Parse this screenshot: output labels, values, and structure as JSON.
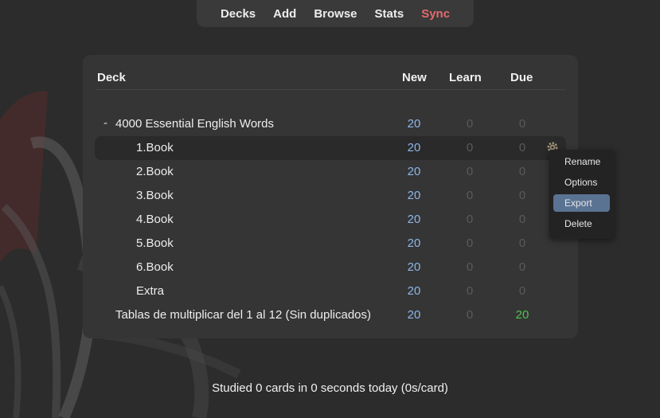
{
  "nav": {
    "decks": "Decks",
    "add": "Add",
    "browse": "Browse",
    "stats": "Stats",
    "sync": "Sync"
  },
  "table": {
    "headers": {
      "deck": "Deck",
      "new": "New",
      "learn": "Learn",
      "due": "Due"
    },
    "rows": [
      {
        "collapse": "-",
        "name": "4000 Essential English Words",
        "new": "20",
        "learn": "0",
        "due": "0"
      },
      {
        "name": "1.Book",
        "new": "20",
        "learn": "0",
        "due": "0"
      },
      {
        "name": "2.Book",
        "new": "20",
        "learn": "0",
        "due": "0"
      },
      {
        "name": "3.Book",
        "new": "20",
        "learn": "0",
        "due": "0"
      },
      {
        "name": "4.Book",
        "new": "20",
        "learn": "0",
        "due": "0"
      },
      {
        "name": "5.Book",
        "new": "20",
        "learn": "0",
        "due": "0"
      },
      {
        "name": "6.Book",
        "new": "20",
        "learn": "0",
        "due": "0"
      },
      {
        "name": "Extra",
        "new": "20",
        "learn": "0",
        "due": "0"
      },
      {
        "name": "Tablas de multiplicar del 1 al 12 (Sin duplicados)",
        "new": "20",
        "learn": "0",
        "due": "20"
      }
    ]
  },
  "context_menu": {
    "items": [
      "Rename",
      "Options",
      "Export",
      "Delete"
    ],
    "highlighted": "Export"
  },
  "gear_icon": "gear-icon",
  "colors": {
    "new": "#8cb6e8",
    "due_active": "#4fc24f",
    "sync": "#e36b6b",
    "menu_highlight": "#5a7393"
  },
  "footer": "Studied 0 cards in 0 seconds today (0s/card)"
}
